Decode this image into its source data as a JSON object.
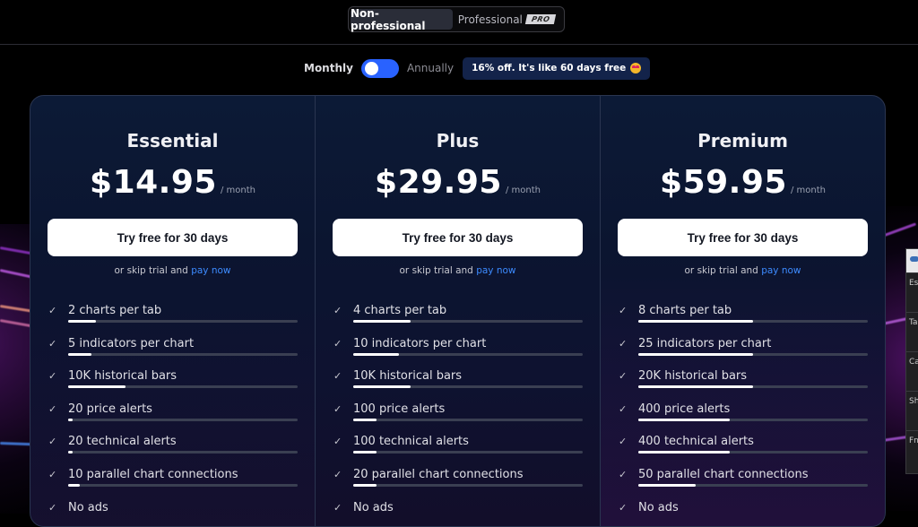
{
  "account_type": {
    "options": [
      "Non-professional",
      "Professional"
    ],
    "selected": "Non-professional",
    "pro_badge": "PRO"
  },
  "billing": {
    "monthly_label": "Monthly",
    "annual_label": "Annually",
    "selected": "Monthly",
    "promo_text": "16% off. It's like 60 days free",
    "promo_icon": "star-struck-emoji"
  },
  "plans": [
    {
      "name": "Essential",
      "price": "$14.95",
      "period": "/ month",
      "cta": "Try free for 30 days",
      "skip_text": "or skip trial and",
      "skip_link": "pay now",
      "features": [
        {
          "label": "2 charts per tab",
          "level": 0.12
        },
        {
          "label": "5 indicators per chart",
          "level": 0.1
        },
        {
          "label": "10K historical bars",
          "level": 0.25
        },
        {
          "label": "20 price alerts",
          "level": 0.02
        },
        {
          "label": "20 technical alerts",
          "level": 0.02
        },
        {
          "label": "10 parallel chart connections",
          "level": 0.05
        },
        {
          "label": "No ads",
          "level": null
        }
      ]
    },
    {
      "name": "Plus",
      "price": "$29.95",
      "period": "/ month",
      "cta": "Try free for 30 days",
      "skip_text": "or skip trial and",
      "skip_link": "pay now",
      "features": [
        {
          "label": "4 charts per tab",
          "level": 0.25
        },
        {
          "label": "10 indicators per chart",
          "level": 0.2
        },
        {
          "label": "10K historical bars",
          "level": 0.25
        },
        {
          "label": "100 price alerts",
          "level": 0.1
        },
        {
          "label": "100 technical alerts",
          "level": 0.1
        },
        {
          "label": "20 parallel chart connections",
          "level": 0.1
        },
        {
          "label": "No ads",
          "level": null
        }
      ]
    },
    {
      "name": "Premium",
      "price": "$59.95",
      "period": "/ month",
      "cta": "Try free for 30 days",
      "skip_text": "or skip trial and",
      "skip_link": "pay now",
      "features": [
        {
          "label": "8 charts per tab",
          "level": 0.5
        },
        {
          "label": "25 indicators per chart",
          "level": 0.5
        },
        {
          "label": "20K historical bars",
          "level": 0.5
        },
        {
          "label": "400 price alerts",
          "level": 0.4
        },
        {
          "label": "400 technical alerts",
          "level": 0.4
        },
        {
          "label": "50 parallel chart connections",
          "level": 0.25
        },
        {
          "label": "No ads",
          "level": null
        }
      ]
    }
  ],
  "on_screen_keyboard": {
    "keys": [
      "Esc",
      "Tab",
      "Caps",
      "Shift",
      "Fn"
    ]
  },
  "colors": {
    "accent": "#2962ff",
    "link": "#3d8bff",
    "promo_bg": "#13234a",
    "card_bg": "#0c1a36"
  }
}
